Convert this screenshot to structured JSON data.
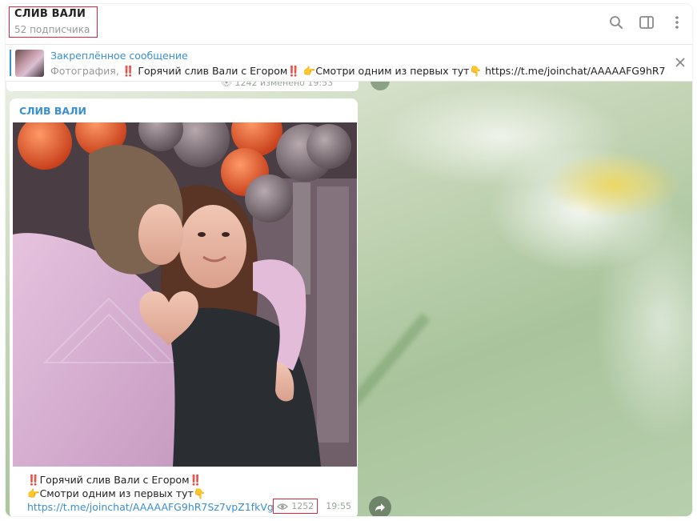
{
  "header": {
    "title": "СЛИВ ВАЛИ",
    "subtitle": "52 подписчика",
    "icons": [
      "search-icon",
      "sidebar-toggle-icon",
      "more-vertical-icon"
    ]
  },
  "pinned": {
    "heading": "Закреплённое сообщение",
    "prefix": "Фотография, ",
    "text": "‼️ Горячий слив Вали с Егором‼️ 👉Смотри одним из первых тут👇 https://t.me/joinchat/AAAAAFG9hR7…",
    "close_icon": "close-icon"
  },
  "previous_message": {
    "meta": "👁 1242   изменено 19:53"
  },
  "message": {
    "sender": "СЛИВ ВАЛИ",
    "line1": "‼️Горячий слив Вали с Егором‼️",
    "line2": "👉Смотри одним из первых тут👇",
    "link": "https://t.me/joinchat/AAAAAFG9hR7Sz7vpZ1fkVg",
    "views": "1252",
    "time": "19:55"
  },
  "colors": {
    "accent": "#3a8fd0",
    "highlight": "#e0263d",
    "meta": "#9aa39a"
  }
}
